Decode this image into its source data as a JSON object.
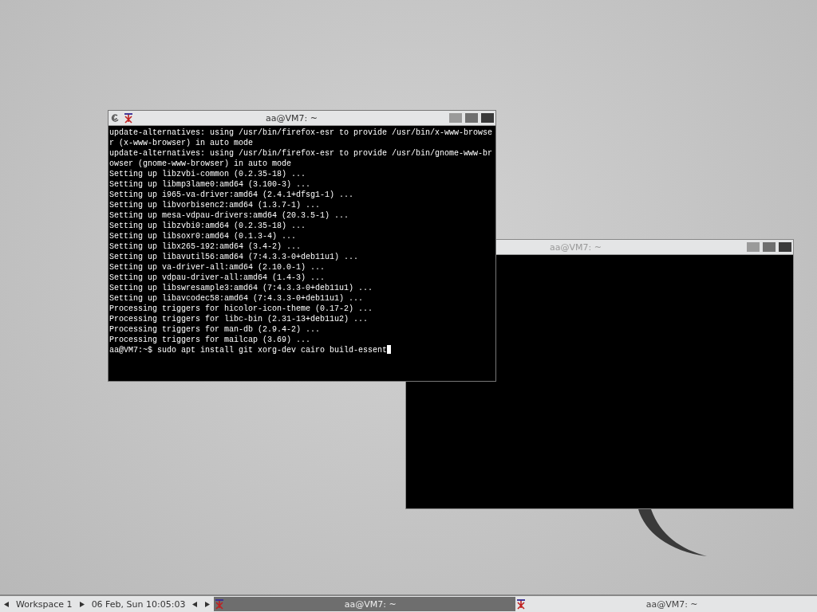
{
  "windows": [
    {
      "title": "aa@VM7: ~",
      "focused": false
    },
    {
      "title": "aa@VM7: ~",
      "focused": true,
      "lines": [
        "update-alternatives: using /usr/bin/firefox-esr to provide /usr/bin/x-www-browse",
        "r (x-www-browser) in auto mode",
        "update-alternatives: using /usr/bin/firefox-esr to provide /usr/bin/gnome-www-br",
        "owser (gnome-www-browser) in auto mode",
        "Setting up libzvbi-common (0.2.35-18) ...",
        "Setting up libmp3lame0:amd64 (3.100-3) ...",
        "Setting up i965-va-driver:amd64 (2.4.1+dfsg1-1) ...",
        "Setting up libvorbisenc2:amd64 (1.3.7-1) ...",
        "Setting up mesa-vdpau-drivers:amd64 (20.3.5-1) ...",
        "Setting up libzvbi0:amd64 (0.2.35-18) ...",
        "Setting up libsoxr0:amd64 (0.1.3-4) ...",
        "Setting up libx265-192:amd64 (3.4-2) ...",
        "Setting up libavutil56:amd64 (7:4.3.3-0+deb11u1) ...",
        "Setting up va-driver-all:amd64 (2.10.0-1) ...",
        "Setting up vdpau-driver-all:amd64 (1.4-3) ...",
        "Setting up libswresample3:amd64 (7:4.3.3-0+deb11u1) ...",
        "Setting up libavcodec58:amd64 (7:4.3.3-0+deb11u1) ...",
        "Processing triggers for hicolor-icon-theme (0.17-2) ...",
        "Processing triggers for libc-bin (2.31-13+deb11u2) ...",
        "Processing triggers for man-db (2.9.4-2) ...",
        "Processing triggers for mailcap (3.69) ..."
      ],
      "prompt": "aa@VM7:~$ sudo apt install git xorg-dev cairo build-essent"
    }
  ],
  "taskbar": {
    "workspace": "Workspace 1",
    "clock": "06 Feb, Sun 10:05:03",
    "tasks": [
      {
        "title": "aa@VM7: ~",
        "selected": true
      },
      {
        "title": "aa@VM7: ~",
        "selected": false
      }
    ]
  }
}
